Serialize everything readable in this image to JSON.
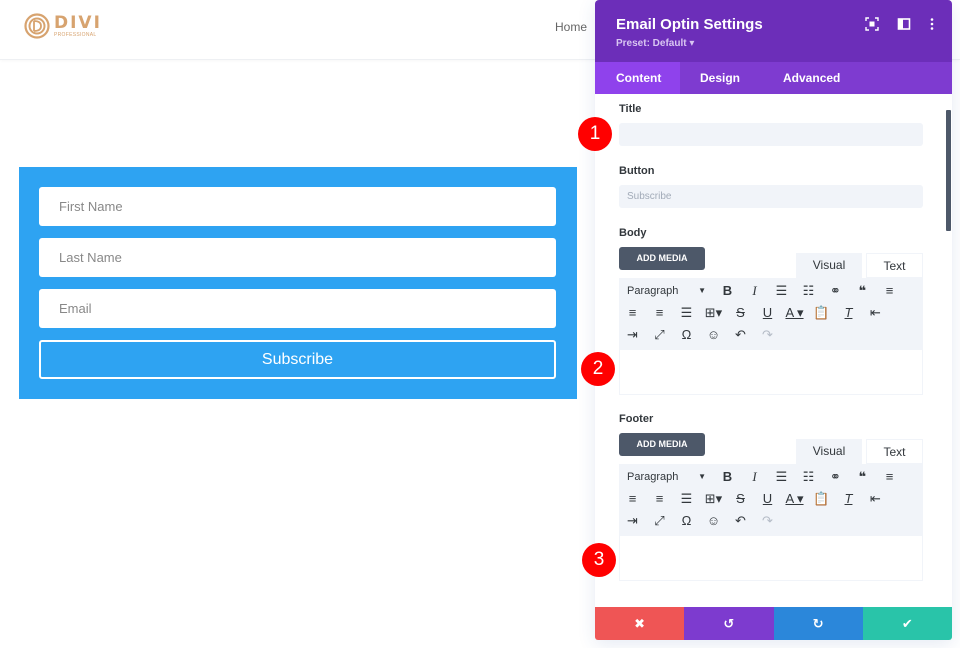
{
  "header": {
    "logo_word": "DIVI",
    "logo_sub": "PROFESSIONAL",
    "nav_home": "Home"
  },
  "optin": {
    "fields": [
      {
        "placeholder": "First Name"
      },
      {
        "placeholder": "Last Name"
      },
      {
        "placeholder": "Email"
      }
    ],
    "button_label": "Subscribe",
    "background_color": "#2ea3f2"
  },
  "panel": {
    "title": "Email Optin Settings",
    "preset": "Preset: Default ▾",
    "tabs": [
      {
        "label": "Content",
        "active": true
      },
      {
        "label": "Design",
        "active": false
      },
      {
        "label": "Advanced",
        "active": false
      }
    ],
    "fields": {
      "title_label": "Title",
      "title_value": "",
      "button_label": "Button",
      "button_placeholder": "Subscribe",
      "body_label": "Body",
      "footer_label": "Footer"
    },
    "editor": {
      "add_media": "ADD MEDIA",
      "visual_tab": "Visual",
      "text_tab": "Text",
      "format_select": "Paragraph",
      "toolbar_row1": [
        "bold-icon",
        "italic-icon",
        "bullet-list-icon",
        "numbered-list-icon",
        "link-icon",
        "blockquote-icon",
        "align-left-icon"
      ],
      "toolbar_row2": [
        "align-center-icon",
        "align-right-icon",
        "align-justify-icon",
        "table-icon",
        "strikethrough-icon",
        "underline-icon",
        "text-color-icon",
        "paste-text-icon",
        "clear-format-icon",
        "outdent-icon"
      ],
      "toolbar_row3": [
        "indent-icon",
        "fullscreen-icon",
        "special-char-icon",
        "emoji-icon",
        "undo-icon",
        "redo-icon"
      ]
    },
    "actions": {
      "cancel": "✖",
      "undo": "↺",
      "redo": "↻",
      "save": "✔"
    },
    "colors": {
      "header": "#6c2eb9",
      "tabs": "#7e3bd0",
      "active_tab": "#8f42ec",
      "cancel": "#ef5555",
      "undo": "#7d3bcf",
      "redo": "#2b87da",
      "save": "#29c4a9"
    }
  },
  "markers": [
    "1",
    "2",
    "3"
  ]
}
